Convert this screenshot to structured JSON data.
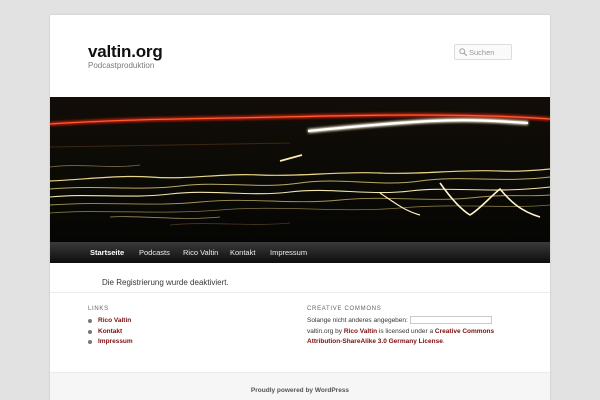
{
  "header": {
    "site_title": "valtin.org",
    "site_description": "Podcastproduktion"
  },
  "search": {
    "placeholder": "Suchen",
    "icon": "search-icon"
  },
  "nav": {
    "items": [
      {
        "label": "Startseite",
        "current": true
      },
      {
        "label": "Podcasts"
      },
      {
        "label": "Rico Valtin"
      },
      {
        "label": "Kontakt"
      },
      {
        "label": "Impressum"
      }
    ]
  },
  "content": {
    "message": "Die Registrierung wurde deaktiviert."
  },
  "widgets": {
    "links": {
      "title": "LINKS",
      "items": [
        "Rico Valtin",
        "Kontakt",
        "Impressum"
      ]
    },
    "cc": {
      "title": "CREATIVE COMMONS",
      "prefix": "Solange nicht anderes angegeben:",
      "site": "valtin.org",
      "by": " by ",
      "author": "Rico Valtin",
      "licensed": " is licensed under a ",
      "license_link": "Creative Commons Attribution-ShareAlike 3.0 Germany License",
      "period": "."
    }
  },
  "footer": {
    "credit": "Proudly powered by WordPress"
  },
  "colors": {
    "link_red": "#7c0e0e",
    "page_bg": "#e2e2e2",
    "nav_bg": "#222222"
  }
}
